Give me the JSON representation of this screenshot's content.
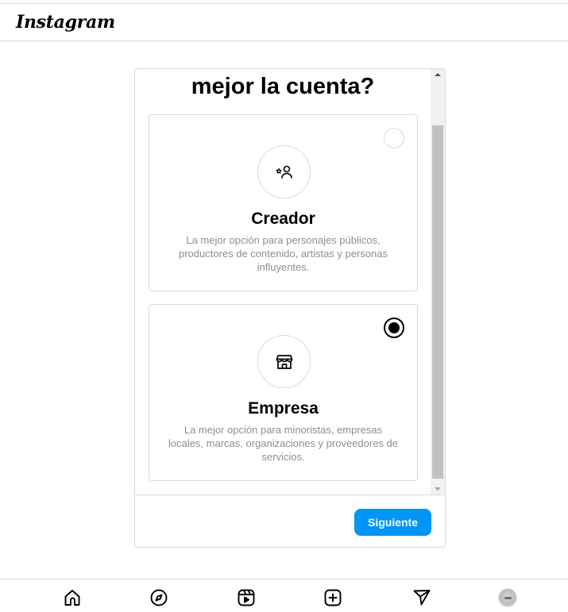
{
  "app": {
    "logo_text": "Instagram"
  },
  "modal": {
    "heading": "mejor la cuenta?",
    "options": [
      {
        "title": "Creador",
        "description": "La mejor opción para personajes públicos, productores de contenido, artistas y personas influyentes.",
        "selected": false,
        "icon": "creator-star-person-icon"
      },
      {
        "title": "Empresa",
        "description": "La mejor opción para minoristas, empresas locales, marcas, organizaciones y proveedores de servicios.",
        "selected": true,
        "icon": "storefront-icon"
      }
    ],
    "next_label": "Siguiente",
    "accent_color": "#0095f6"
  },
  "bottom_nav": {
    "items": [
      "home-icon",
      "explore-compass-icon",
      "reels-icon",
      "create-plus-icon",
      "direct-messages-icon",
      "profile-avatar"
    ]
  }
}
